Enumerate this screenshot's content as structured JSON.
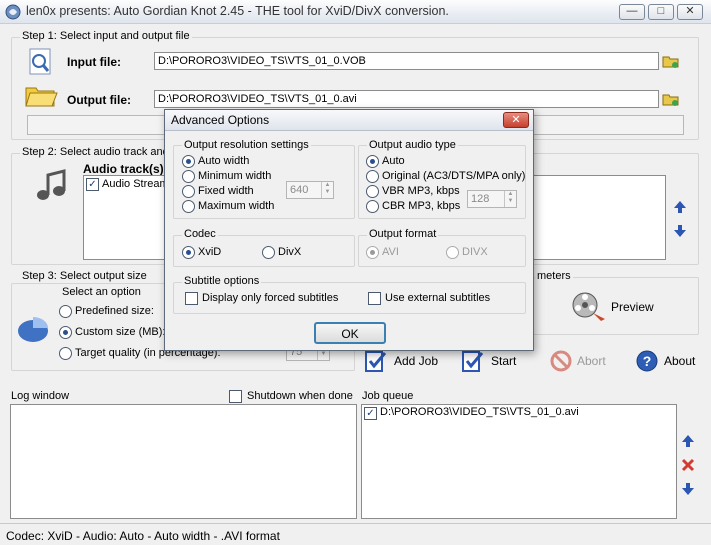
{
  "window": {
    "title": "len0x presents: Auto Gordian Knot 2.45 - THE tool for XviD/DivX conversion.",
    "minimize_glyph": "—",
    "maximize_glyph": "□",
    "close_glyph": "✕"
  },
  "step1": {
    "label": "Step 1: Select input and output file",
    "input_label": "Input file:",
    "input_value": "D:\\PORORO3\\VIDEO_TS\\VTS_01_0.VOB",
    "output_label": "Output file:",
    "output_value": "D:\\PORORO3\\VIDEO_TS\\VTS_01_0.avi"
  },
  "step2": {
    "label": "Step 2: Select audio track and",
    "audio_tracks_label": "Audio track(s)",
    "audio_item": "Audio Stream"
  },
  "step3": {
    "label": "Step 3: Select output size",
    "select_option": "Select an option",
    "predefined": "Predefined size:",
    "custom": "Custom size (MB):",
    "target_quality": "Target quality (in percentage):",
    "target_quality_value": "75"
  },
  "step4": {
    "label": "meters",
    "preview": "Preview"
  },
  "actions": {
    "add_job": "Add Job",
    "start": "Start",
    "abort": "Abort",
    "about": "About"
  },
  "log": {
    "label": "Log window",
    "shutdown": "Shutdown when done"
  },
  "jobqueue": {
    "label": "Job queue",
    "items": [
      "D:\\PORORO3\\VIDEO_TS\\VTS_01_0.avi"
    ]
  },
  "statusbar": {
    "text": "Codec: XviD -  Audio: Auto -  Auto width - .AVI format"
  },
  "dialog": {
    "title": "Advanced Options",
    "close_glyph": "✕",
    "resolution": {
      "label": "Output resolution settings",
      "auto_width": "Auto width",
      "minimum_width": "Minimum width",
      "fixed_width": "Fixed width",
      "fixed_width_value": "640",
      "maximum_width": "Maximum width"
    },
    "audio_type": {
      "label": "Output audio type",
      "auto": "Auto",
      "original": "Original (AC3/DTS/MPA only)",
      "vbr": "VBR MP3, kbps",
      "cbr": "CBR MP3, kbps",
      "cbr_value": "128"
    },
    "codec": {
      "label": "Codec",
      "xvid": "XviD",
      "divx": "DivX"
    },
    "format": {
      "label": "Output format",
      "avi": "AVI",
      "divx": "DIVX"
    },
    "subtitle": {
      "label": "Subtitle options",
      "forced": "Display only forced subtitles",
      "external": "Use external subtitles"
    },
    "ok": "OK"
  },
  "colors": {
    "arrow_blue": "#2b57b3",
    "delete_red": "#d23b2f",
    "abort_disabled": "#9a9a9a"
  }
}
